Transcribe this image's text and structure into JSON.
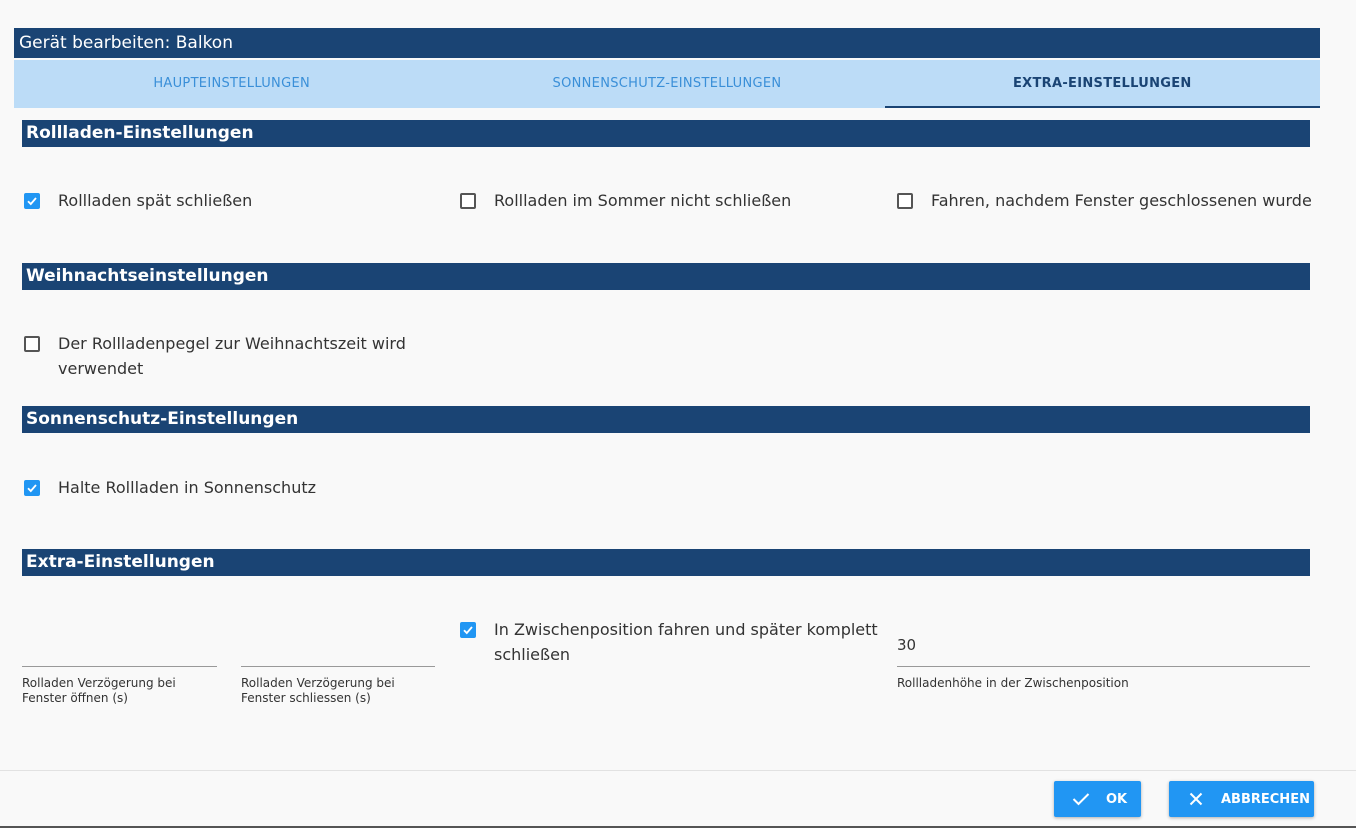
{
  "dialog": {
    "title": "Gerät bearbeiten: Balkon"
  },
  "tabs": [
    {
      "label": "HAUPTEINSTELLUNGEN",
      "active": false
    },
    {
      "label": "SONNENSCHUTZ-EINSTELLUNGEN",
      "active": false
    },
    {
      "label": "EXTRA-EINSTELLUNGEN",
      "active": true
    }
  ],
  "sections": {
    "rollladen": {
      "title": "Rollladen-Einstellungen",
      "options": [
        {
          "label": "Rollladen spät schließen",
          "checked": true
        },
        {
          "label": "Rollladen im Sommer nicht schließen",
          "checked": false
        },
        {
          "label": "Fahren, nachdem Fenster geschlossenen wurde",
          "checked": false
        }
      ]
    },
    "weihnacht": {
      "title": "Weihnachtseinstellungen",
      "options": [
        {
          "label": "Der Rollladenpegel zur Weihnachtszeit wird verwendet",
          "checked": false
        }
      ]
    },
    "sonnenschutz": {
      "title": "Sonnenschutz-Einstellungen",
      "options": [
        {
          "label": "Halte Rollladen in Sonnenschutz",
          "checked": true
        }
      ]
    },
    "extra": {
      "title": "Extra-Einstellungen",
      "fields": [
        {
          "value": "",
          "caption": "Rolladen Verzögerung bei Fenster öffnen (s)"
        },
        {
          "value": "",
          "caption": "Rolladen Verzögerung bei Fenster schliessen (s)"
        },
        {
          "value": "30",
          "caption": "Rollladenhöhe in der Zwischenposition"
        }
      ],
      "options": [
        {
          "label": "In Zwischenposition fahren und später komplett schließen",
          "checked": true
        }
      ]
    }
  },
  "buttons": {
    "ok_label": "OK",
    "cancel_label": "ABBRECHEN"
  },
  "colors": {
    "header_bg": "#1a4474",
    "tab_bg": "#bcdcf7",
    "accent": "#2196f3"
  }
}
